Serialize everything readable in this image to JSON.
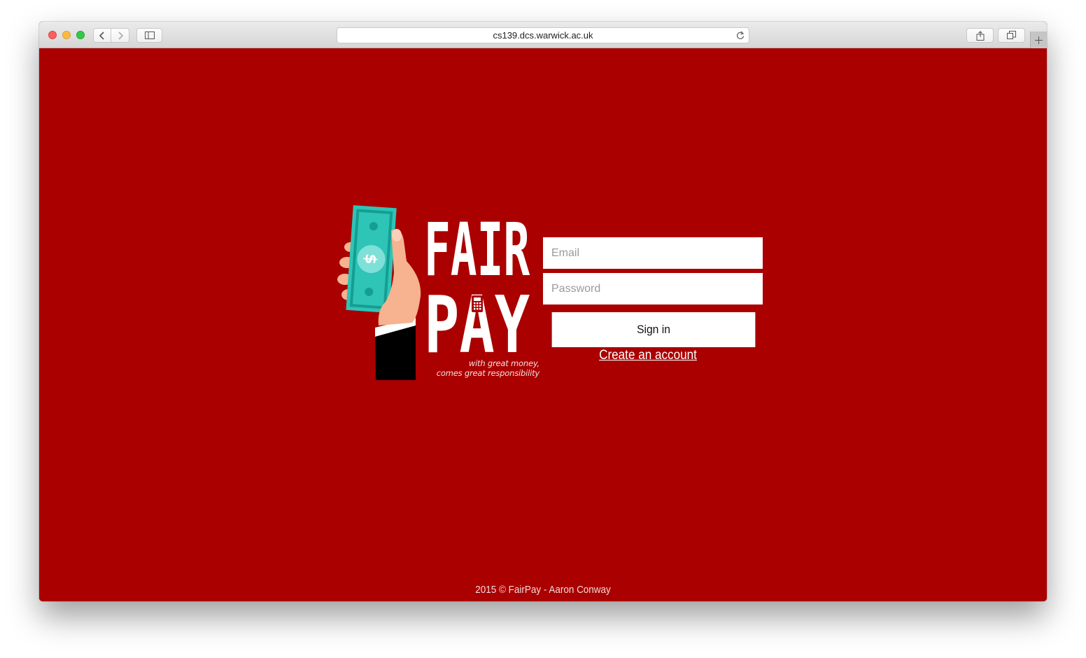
{
  "browser": {
    "url": "cs139.dcs.warwick.ac.uk",
    "icons": [
      "back-icon",
      "forward-icon",
      "sidebar-icon",
      "reload-icon",
      "share-icon",
      "tabs-icon",
      "new-tab-icon"
    ]
  },
  "brand": {
    "logo_line1": "FAIR",
    "logo_line2": "PAY",
    "tagline_line1": "with great money,",
    "tagline_line2": "comes great responsibility",
    "colors": {
      "background": "#aa0000",
      "bill": "#2ec4b6",
      "bill_dark": "#149e92",
      "text": "#ffffff"
    }
  },
  "login": {
    "email_placeholder": "Email",
    "password_placeholder": "Password",
    "signin_label": "Sign in",
    "create_account_label": "Create an account"
  },
  "footer": {
    "text": "2015 © FairPay - Aaron Conway"
  }
}
